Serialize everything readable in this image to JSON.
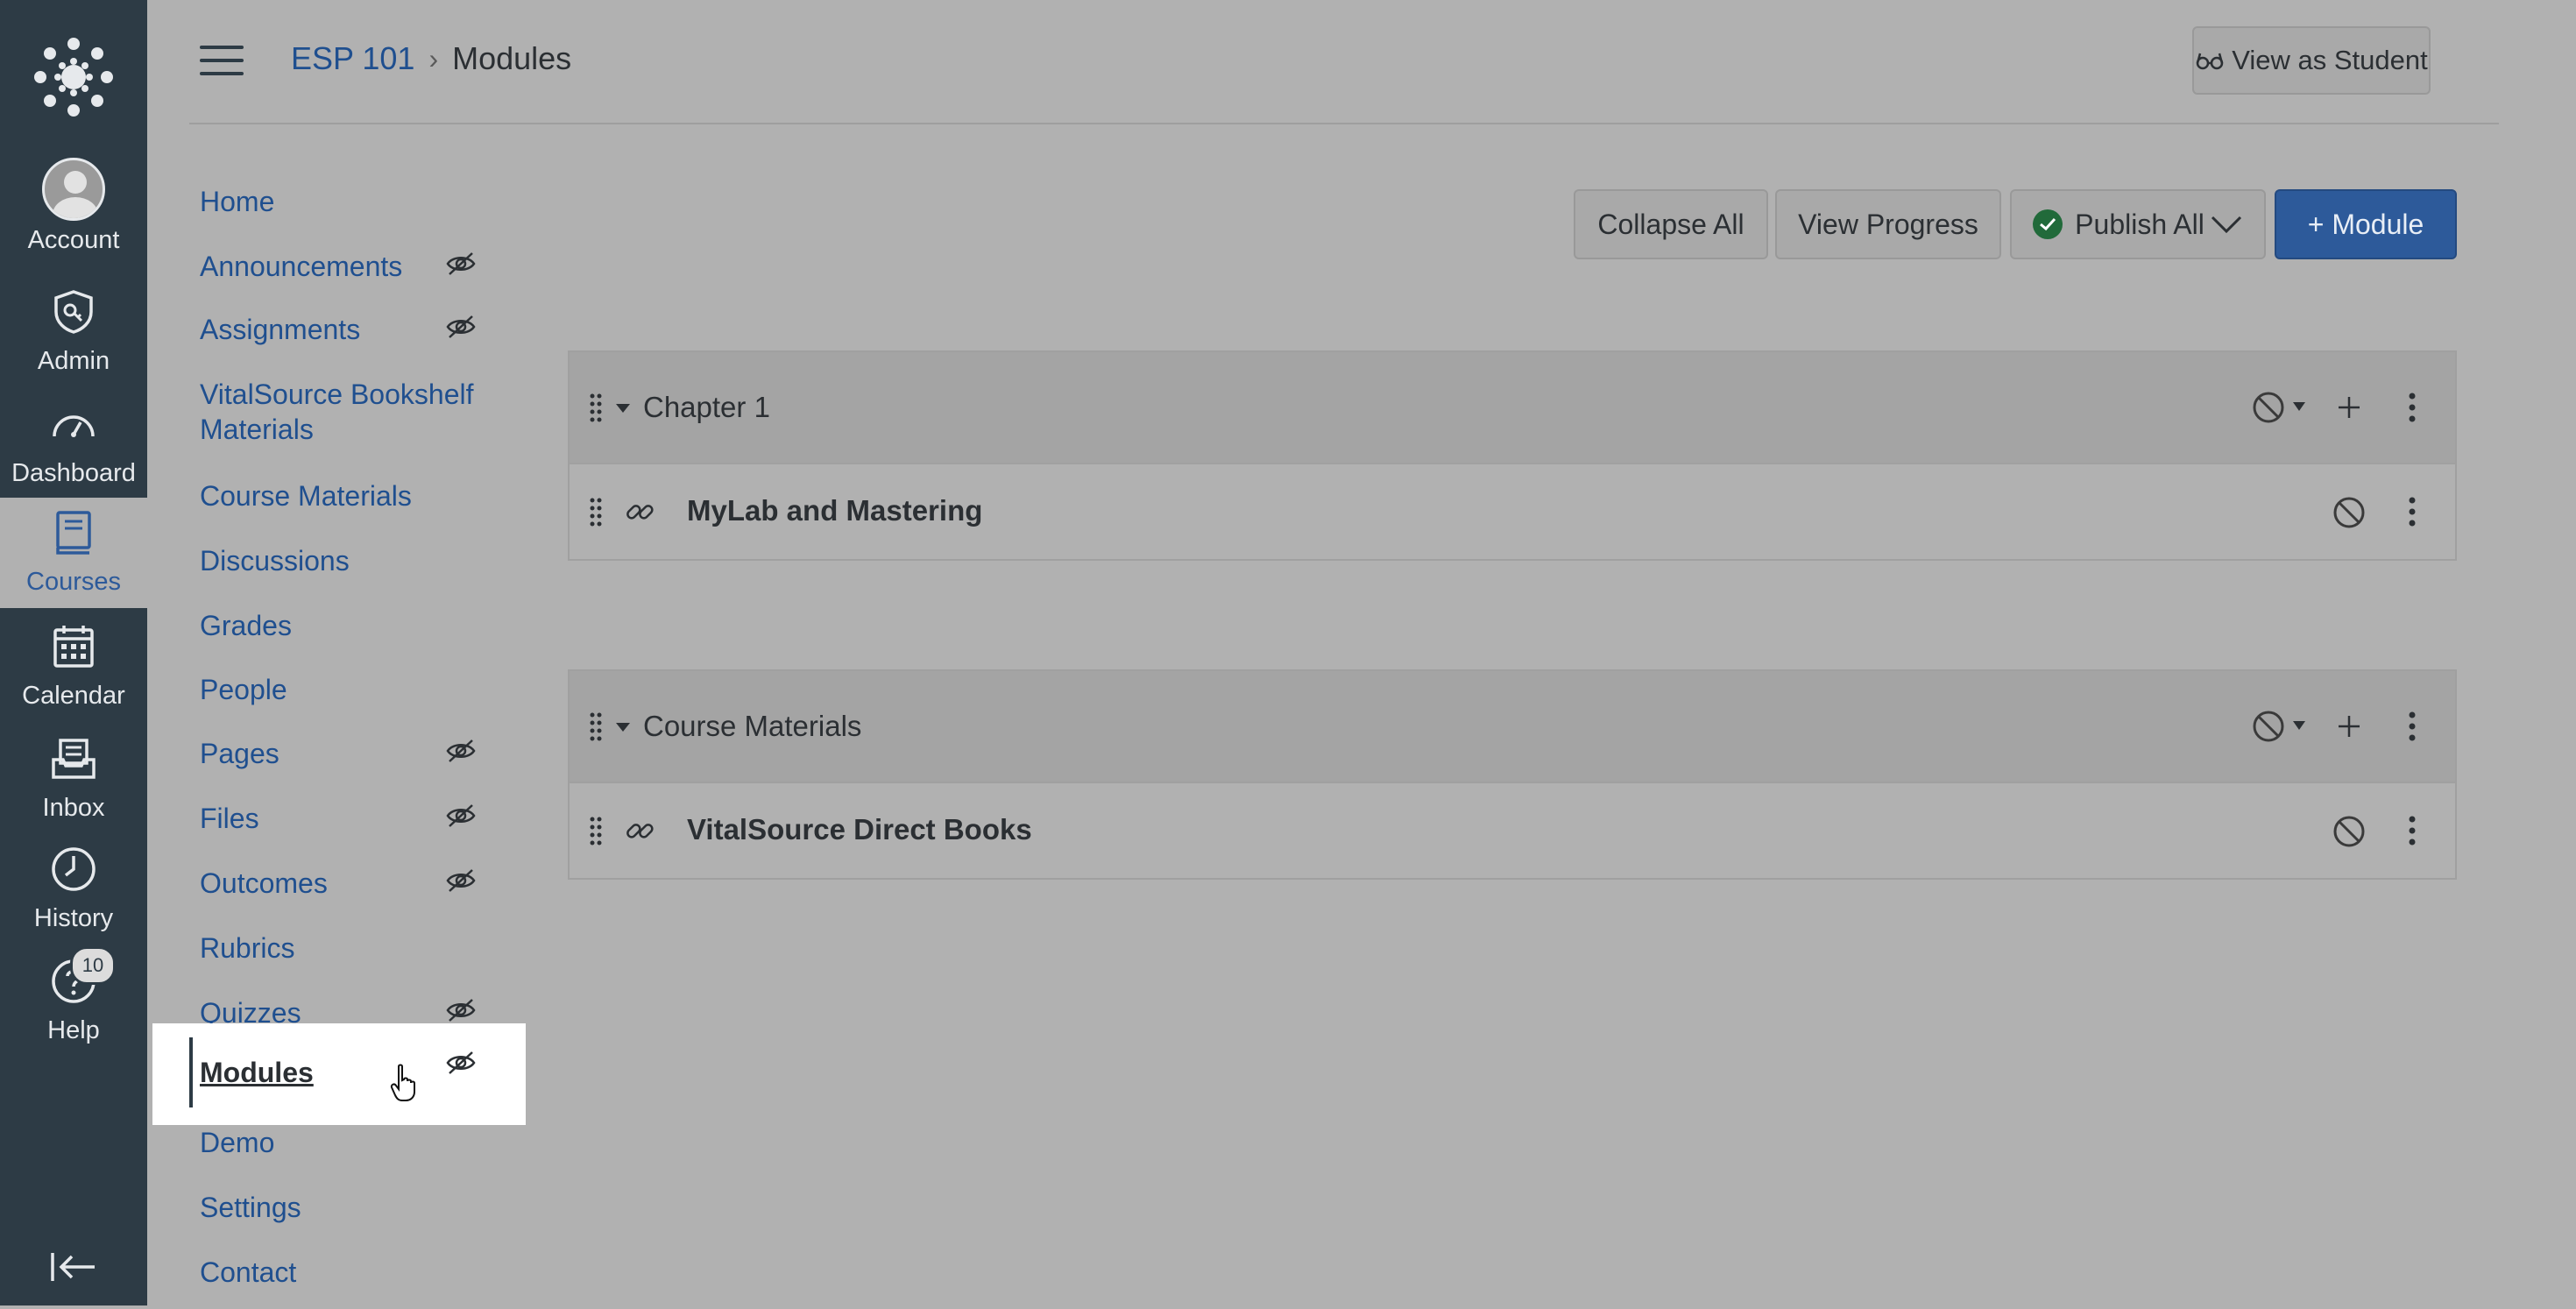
{
  "global_nav": {
    "items": [
      {
        "label": "Account",
        "icon": "account-avatar-icon"
      },
      {
        "label": "Admin",
        "icon": "admin-shield-icon"
      },
      {
        "label": "Dashboard",
        "icon": "dashboard-gauge-icon"
      },
      {
        "label": "Courses",
        "icon": "courses-book-icon",
        "active": true
      },
      {
        "label": "Calendar",
        "icon": "calendar-icon"
      },
      {
        "label": "Inbox",
        "icon": "inbox-icon"
      },
      {
        "label": "History",
        "icon": "history-clock-icon"
      },
      {
        "label": "Help",
        "icon": "help-question-icon",
        "badge": "10"
      }
    ],
    "collapse_icon": "collapse-nav-icon"
  },
  "header": {
    "breadcrumb_course": "ESP 101",
    "breadcrumb_separator": "›",
    "breadcrumb_current": "Modules",
    "view_as_student": "View as Student"
  },
  "course_nav": {
    "items": [
      {
        "label": "Home",
        "hidden": false
      },
      {
        "label": "Announcements",
        "hidden": true
      },
      {
        "label": "Assignments",
        "hidden": true
      },
      {
        "label": "VitalSource Bookshelf Materials",
        "hidden": false
      },
      {
        "label": "Course Materials",
        "hidden": false
      },
      {
        "label": "Discussions",
        "hidden": false
      },
      {
        "label": "Grades",
        "hidden": false
      },
      {
        "label": "People",
        "hidden": false
      },
      {
        "label": "Pages",
        "hidden": true
      },
      {
        "label": "Files",
        "hidden": true
      },
      {
        "label": "Outcomes",
        "hidden": true
      },
      {
        "label": "Rubrics",
        "hidden": false
      },
      {
        "label": "Quizzes",
        "hidden": true
      },
      {
        "label": "Modules",
        "hidden": true,
        "active": true
      },
      {
        "label": "Demo",
        "hidden": false
      },
      {
        "label": "Settings",
        "hidden": false
      },
      {
        "label": "Contact",
        "hidden": false
      }
    ]
  },
  "toolbar": {
    "collapse_all": "Collapse All",
    "view_progress": "View Progress",
    "publish_all": "Publish All",
    "add_module": "+ Module"
  },
  "modules": [
    {
      "title": "Chapter 1",
      "items": [
        {
          "title": "MyLab and Mastering",
          "type": "link"
        }
      ]
    },
    {
      "title": "Course Materials",
      "items": [
        {
          "title": "VitalSource Direct Books",
          "type": "link"
        }
      ]
    }
  ],
  "colors": {
    "nav_bg": "#2d3b45",
    "page_bg": "#b1b1b1",
    "link": "#1f4f8f",
    "primary": "#2d5a9a",
    "publish_green": "#216a3a"
  }
}
